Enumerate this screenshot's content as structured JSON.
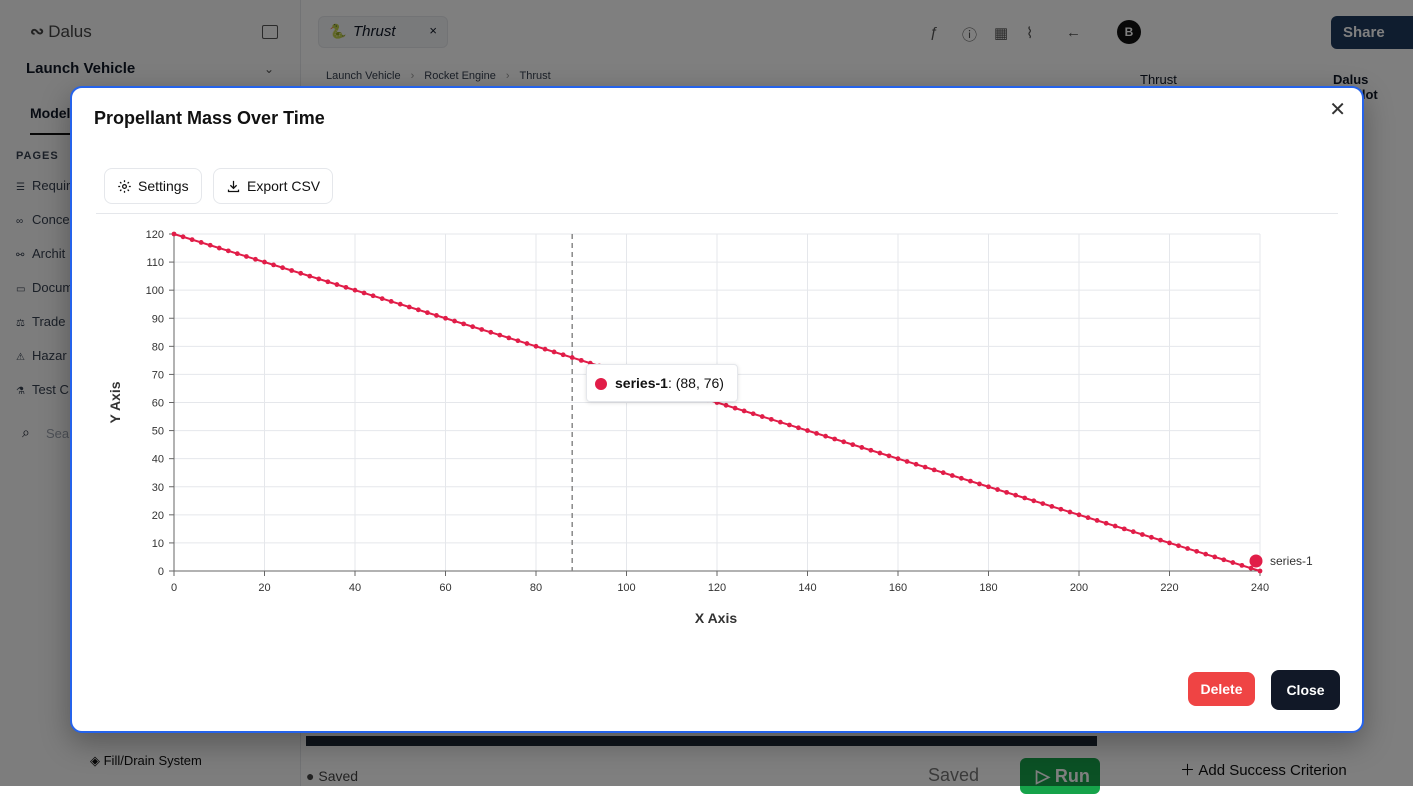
{
  "app": {
    "logo": "Dalus",
    "project": "Launch Vehicle",
    "model_tab": "Model",
    "pages_header": "PAGES",
    "pages": [
      "Requir",
      "Conce",
      "Archit",
      "Docum",
      "Trade",
      "Hazar",
      "Test C"
    ],
    "search_placeholder": "Sea",
    "tree": [
      "Fill/Drain System"
    ],
    "editor_tab": "Thrust",
    "breadcrumb": [
      "Launch Vehicle",
      "Rocket Engine",
      "Thrust"
    ],
    "avatar": "B",
    "share_label": "Share",
    "right_tabs": [
      "Thrust",
      "Dalus Copilot"
    ],
    "saved_status": "Saved",
    "saved_right": "Saved",
    "run_label": "Run",
    "add_success": "Add Success Criterion"
  },
  "modal": {
    "title": "Propellant Mass Over Time",
    "settings_label": "Settings",
    "export_label": "Export CSV",
    "delete_label": "Delete",
    "close_label": "Close",
    "tooltip": {
      "series": "series-1",
      "value": ": (88, 76)"
    }
  },
  "chart_data": {
    "type": "line",
    "title": "",
    "xlabel": "X Axis",
    "ylabel": "Y Axis",
    "xlim": [
      0,
      240
    ],
    "ylim": [
      0,
      120
    ],
    "xticks": [
      0,
      20,
      40,
      60,
      80,
      100,
      120,
      140,
      160,
      180,
      200,
      220,
      240
    ],
    "yticks": [
      0,
      10,
      20,
      30,
      40,
      50,
      60,
      70,
      80,
      90,
      100,
      110,
      120
    ],
    "grid": true,
    "legend": "right",
    "series": [
      {
        "name": "series-1",
        "color": "#e11d48",
        "x_start": 0,
        "x_end": 240,
        "x_step": 2,
        "y_start": 120,
        "y_end": 0
      }
    ],
    "hover": {
      "x": 88,
      "y": 76
    }
  }
}
